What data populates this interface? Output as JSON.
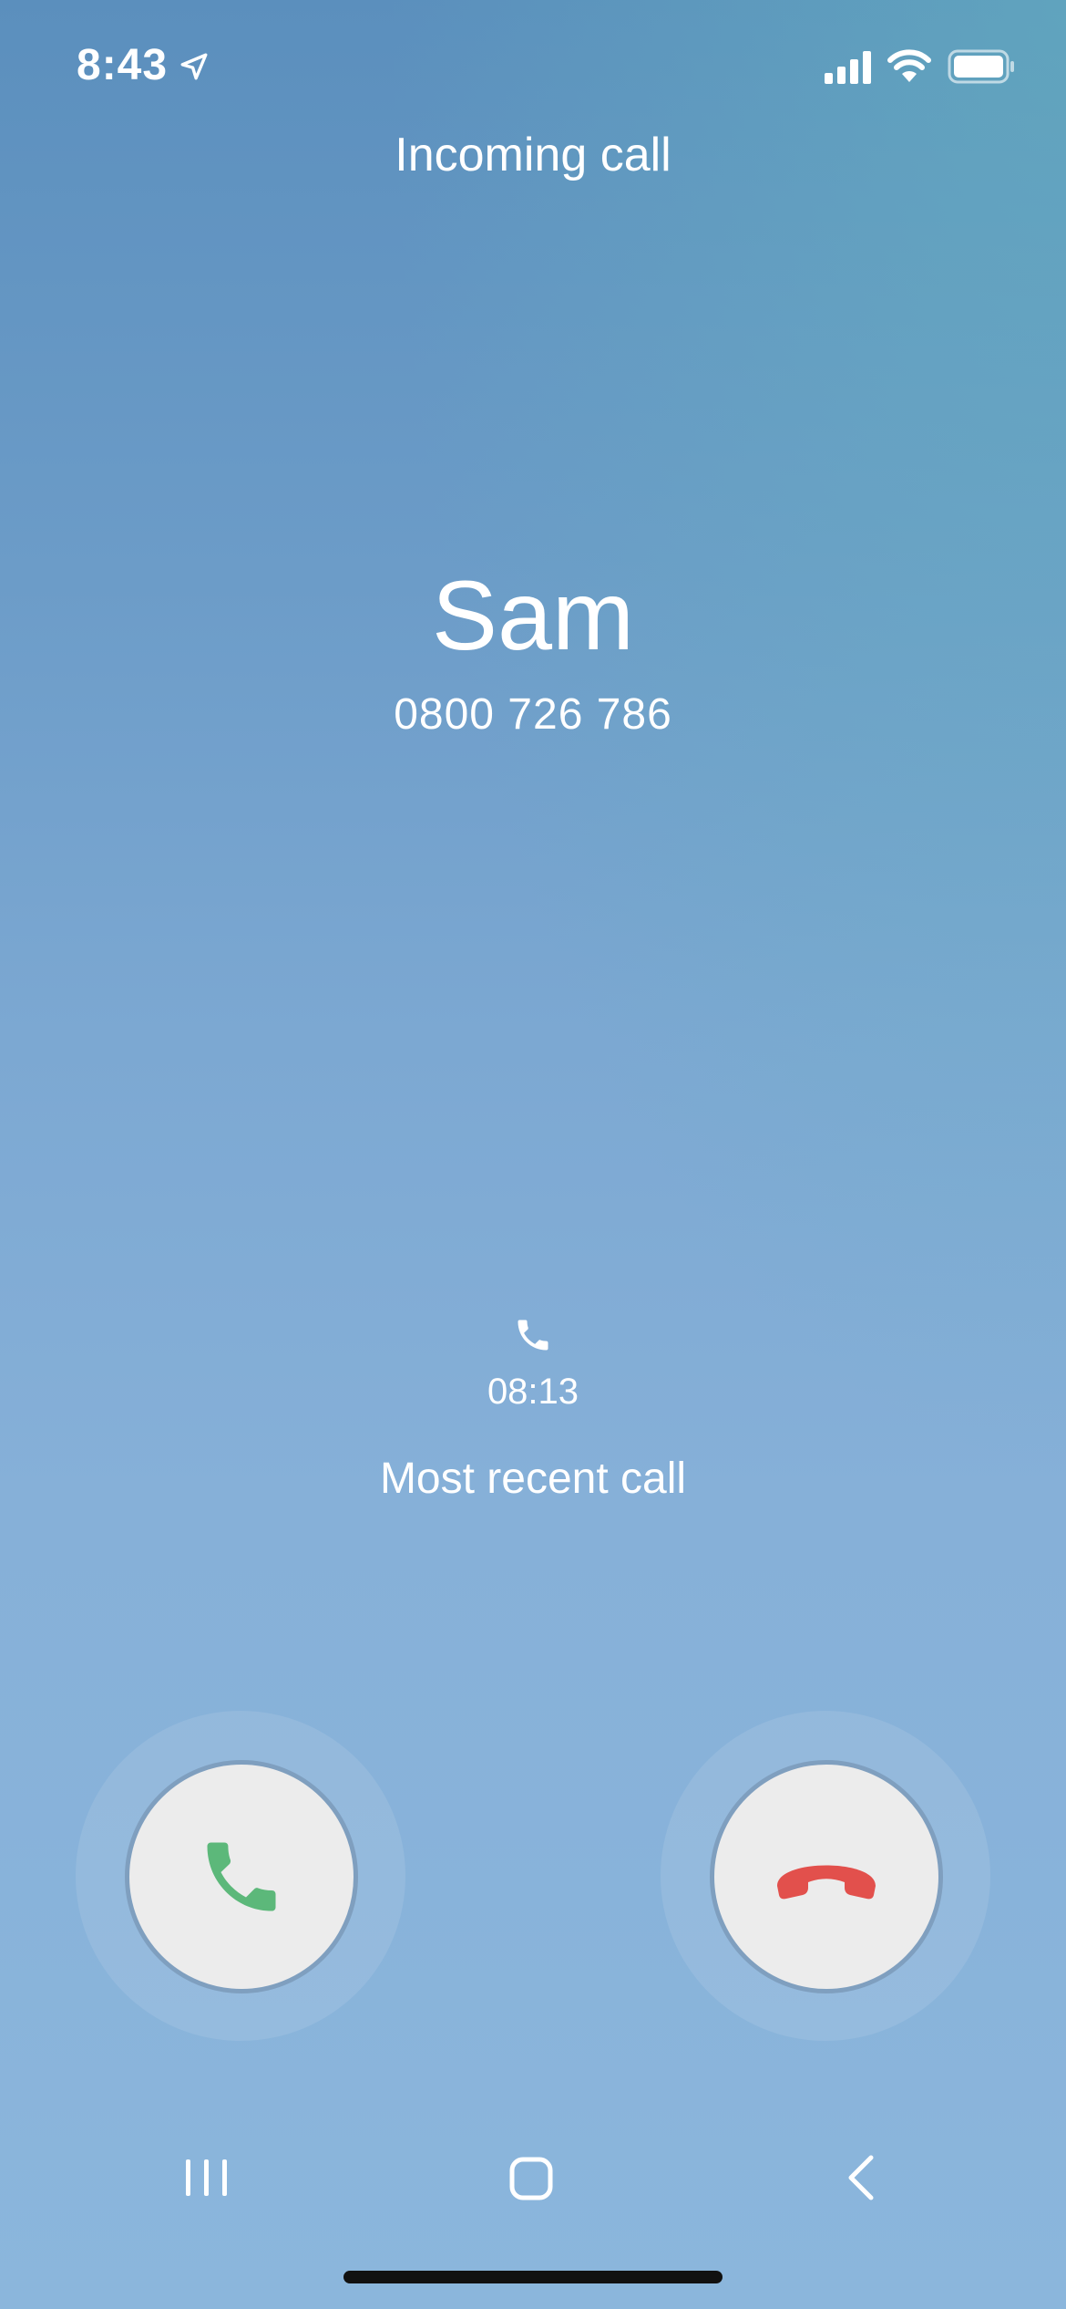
{
  "status_bar": {
    "time": "8:43",
    "location_icon": "location-arrow-icon",
    "signal_icon": "cellular-signal-icon",
    "wifi_icon": "wifi-icon",
    "battery_icon": "battery-icon"
  },
  "call": {
    "status": "Incoming call",
    "caller_name": "Sam",
    "caller_number": "0800 726 786"
  },
  "recent": {
    "icon": "phone-icon",
    "time": "08:13",
    "label": "Most recent call"
  },
  "actions": {
    "answer_icon": "phone-answer-icon",
    "answer_color": "#5cb87a",
    "decline_icon": "phone-decline-icon",
    "decline_color": "#e2504c"
  },
  "nav": {
    "recents_icon": "recent-apps-icon",
    "home_icon": "home-icon",
    "back_icon": "back-chevron-icon"
  }
}
